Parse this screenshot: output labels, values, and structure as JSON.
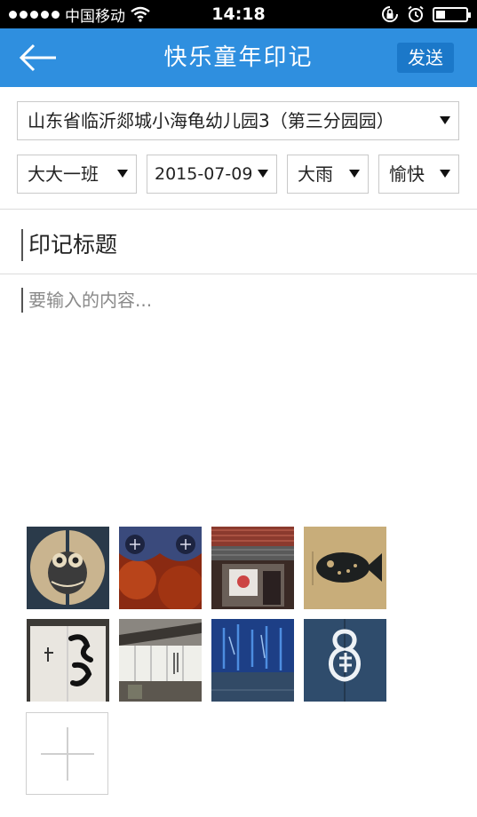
{
  "status_bar": {
    "carrier": "中国移动",
    "time": "14:18",
    "icons": [
      "signal-dots-icon",
      "wifi-icon",
      "rotation-lock-icon",
      "alarm-icon",
      "battery-icon"
    ]
  },
  "nav": {
    "title": "快乐童年印记",
    "send_label": "发送",
    "back_icon": "back-arrow-icon",
    "bar_color": "#2f8fdf"
  },
  "selectors": {
    "school": "山东省临沂郯城小海龟幼儿园3（第三分园园）",
    "class": "大大一班",
    "date": "2015-07-09",
    "weather": "大雨",
    "mood": "愉快"
  },
  "form": {
    "title_placeholder": "印记标题",
    "content_placeholder": "要输入的内容..."
  },
  "images": [
    {
      "name": "owl-noren-photo"
    },
    {
      "name": "autumn-noren-photo"
    },
    {
      "name": "lantern-house-photo"
    },
    {
      "name": "pufferfish-noren-photo"
    },
    {
      "name": "calligraphy-noren-photo"
    },
    {
      "name": "shopfront-noren-photo"
    },
    {
      "name": "blue-calligraphy-noren-photo"
    },
    {
      "name": "gourd-noren-photo"
    }
  ],
  "add_image_icon": "plus-icon"
}
